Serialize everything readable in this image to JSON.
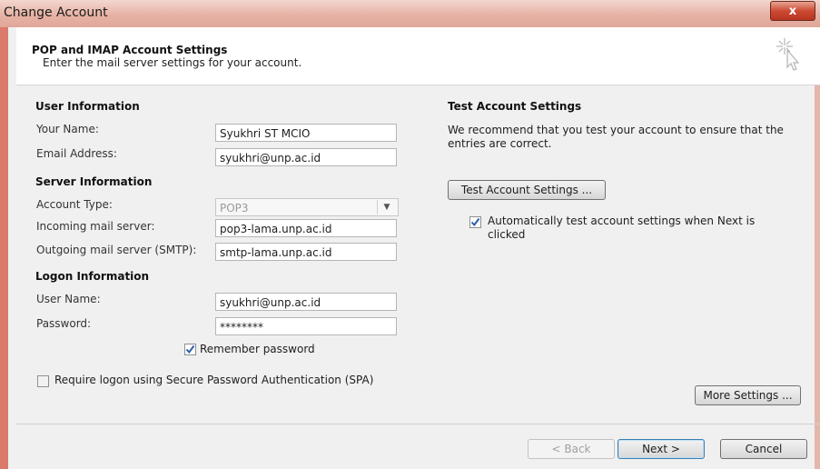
{
  "window": {
    "title": "Change Account",
    "close_symbol": "x"
  },
  "header": {
    "title": "POP and IMAP Account Settings",
    "subtitle": "Enter the mail server settings for your account.",
    "icon": "cursor-sparkle-icon"
  },
  "user_information": {
    "heading": "User Information",
    "your_name_label": "Your Name:",
    "your_name_value": "Syukhri ST MCIO",
    "email_label": "Email Address:",
    "email_value": "syukhri@unp.ac.id"
  },
  "server_information": {
    "heading": "Server Information",
    "account_type_label": "Account Type:",
    "account_type_value": "POP3",
    "incoming_label": "Incoming mail server:",
    "incoming_value": "pop3-lama.unp.ac.id",
    "outgoing_label": "Outgoing mail server (SMTP):",
    "outgoing_value": "smtp-lama.unp.ac.id"
  },
  "logon_information": {
    "heading": "Logon Information",
    "username_label": "User Name:",
    "username_value": "syukhri@unp.ac.id",
    "password_label": "Password:",
    "password_value": "********",
    "remember_label": "Remember password",
    "remember_checked": true,
    "spa_label": "Require logon using Secure Password Authentication (SPA)",
    "spa_checked": false
  },
  "test_settings": {
    "heading": "Test Account Settings",
    "description": "We recommend that you test your account to ensure that the entries are correct.",
    "button_label": "Test Account Settings ...",
    "auto_test_label": "Automatically test account settings when Next is clicked",
    "auto_test_checked": true
  },
  "buttons": {
    "more_settings": "More Settings ...",
    "back": "< Back",
    "next": "Next >",
    "cancel": "Cancel"
  },
  "colors": {
    "titlebar": "#e7b2a5",
    "check": "#2a5ea8"
  }
}
